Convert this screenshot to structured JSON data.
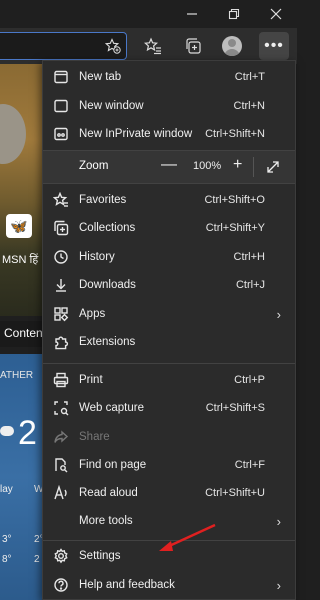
{
  "toolbar": {
    "more_label": "•••"
  },
  "background": {
    "msn_text": "MSN हिं",
    "content_tab": "Conten",
    "weather_label": "ATHER",
    "big_temp": "2",
    "day1": "lay",
    "day2": "W",
    "temp1": "3°",
    "temp2": "2°",
    "temp3": "8°",
    "temp4": "2"
  },
  "menu": {
    "new_tab": {
      "label": "New tab",
      "shortcut": "Ctrl+T"
    },
    "new_window": {
      "label": "New window",
      "shortcut": "Ctrl+N"
    },
    "inprivate": {
      "label": "New InPrivate window",
      "shortcut": "Ctrl+Shift+N"
    },
    "zoom": {
      "label": "Zoom",
      "minus": "—",
      "value": "100%",
      "plus": "+"
    },
    "favorites": {
      "label": "Favorites",
      "shortcut": "Ctrl+Shift+O"
    },
    "collections": {
      "label": "Collections",
      "shortcut": "Ctrl+Shift+Y"
    },
    "history": {
      "label": "History",
      "shortcut": "Ctrl+H"
    },
    "downloads": {
      "label": "Downloads",
      "shortcut": "Ctrl+J"
    },
    "apps": {
      "label": "Apps"
    },
    "extensions": {
      "label": "Extensions"
    },
    "print": {
      "label": "Print",
      "shortcut": "Ctrl+P"
    },
    "web_capture": {
      "label": "Web capture",
      "shortcut": "Ctrl+Shift+S"
    },
    "share": {
      "label": "Share"
    },
    "find": {
      "label": "Find on page",
      "shortcut": "Ctrl+F"
    },
    "read_aloud": {
      "label": "Read aloud",
      "shortcut": "Ctrl+Shift+U"
    },
    "more_tools": {
      "label": "More tools"
    },
    "settings": {
      "label": "Settings"
    },
    "help": {
      "label": "Help and feedback"
    }
  },
  "colors": {
    "menu_bg": "#2b2b2b",
    "accent_arrow": "#e02020"
  }
}
